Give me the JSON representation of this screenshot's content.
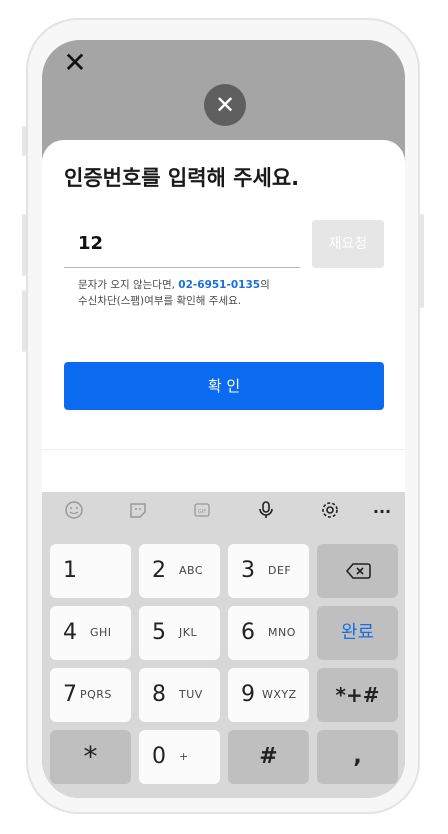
{
  "sheet": {
    "title": "인증번호를 입력해 주세요.",
    "code_value": "12",
    "resend_label": "재요청",
    "help_prefix": "문자가 오지 않는다면,",
    "help_phone": "02-6951-0135",
    "help_suffix": "의",
    "help_line2": "수신차단(스팸)여부를 확인해 주세요.",
    "confirm_label": "확 인"
  },
  "icons": {
    "top_close": "close-icon",
    "float_close": "close-circle-icon",
    "keyboard_toolbar": [
      "emoji-icon",
      "sticker-icon",
      "gif-icon",
      "microphone-icon",
      "gear-icon",
      "more-icon"
    ]
  },
  "keyboard": {
    "keys": [
      {
        "main": "1",
        "sub": ""
      },
      {
        "main": "2",
        "sub": "ABC"
      },
      {
        "main": "3",
        "sub": "DEF"
      },
      {
        "main": "4",
        "sub": "GHI"
      },
      {
        "main": "5",
        "sub": "JKL"
      },
      {
        "main": "6",
        "sub": "MNO"
      },
      {
        "main": "7",
        "sub": "PQRS"
      },
      {
        "main": "8",
        "sub": "TUV"
      },
      {
        "main": "9",
        "sub": "WXYZ"
      },
      {
        "main": "0",
        "sub": "+"
      }
    ],
    "done_label": "완료",
    "symbols_label": "*+#",
    "star_label": "*",
    "hash_label": "#",
    "comma_label": ","
  },
  "colors": {
    "accent": "#0a6af0",
    "link": "#1a6fe0",
    "overlay": "#a5a5a5"
  }
}
